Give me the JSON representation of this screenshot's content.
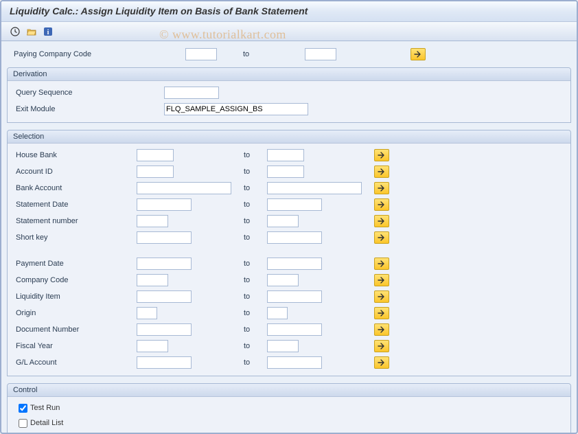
{
  "window": {
    "title": "Liquidity Calc.: Assign Liquidity Item on Basis of Bank Statement"
  },
  "watermark": "© www.tutorialkart.com",
  "toolbar": {
    "execute": "execute",
    "variant": "get-variant",
    "info": "information"
  },
  "top": {
    "paying_cc_label": "Paying Company Code",
    "paying_cc_from": "",
    "to_label": "to",
    "paying_cc_to": ""
  },
  "derivation": {
    "title": "Derivation",
    "query_seq_label": "Query Sequence",
    "query_seq": "",
    "exit_module_label": "Exit Module",
    "exit_module": "FLQ_SAMPLE_ASSIGN_BS"
  },
  "selection": {
    "title": "Selection",
    "to_label": "to",
    "rows": [
      {
        "key": "house_bank",
        "label": "House Bank",
        "wfrom": "w-s2",
        "wto": "w-s2",
        "from": "",
        "to": ""
      },
      {
        "key": "account_id",
        "label": "Account ID",
        "wfrom": "w-s2",
        "wto": "w-s2",
        "from": "",
        "to": ""
      },
      {
        "key": "bank_account",
        "label": "Bank Account",
        "wfrom": "w-lg",
        "wto": "w-lg",
        "from": "",
        "to": ""
      },
      {
        "key": "stmt_date",
        "label": "Statement Date",
        "wfrom": "w-md",
        "wto": "w-md",
        "from": "",
        "to": ""
      },
      {
        "key": "stmt_number",
        "label": "Statement number",
        "wfrom": "w-sm",
        "wto": "w-sm",
        "from": "",
        "to": ""
      },
      {
        "key": "short_key",
        "label": "Short key",
        "wfrom": "w-md",
        "wto": "w-md",
        "from": "",
        "to": ""
      }
    ],
    "rows2": [
      {
        "key": "payment_date",
        "label": "Payment Date",
        "wfrom": "w-md",
        "wto": "w-md",
        "from": "",
        "to": ""
      },
      {
        "key": "company_code",
        "label": "Company Code",
        "wfrom": "w-sm",
        "wto": "w-sm",
        "from": "",
        "to": ""
      },
      {
        "key": "liq_item",
        "label": "Liquidity Item",
        "wfrom": "w-md",
        "wto": "w-md",
        "from": "",
        "to": ""
      },
      {
        "key": "origin",
        "label": "Origin",
        "wfrom": "w-xs",
        "wto": "w-xs",
        "from": "",
        "to": ""
      },
      {
        "key": "doc_number",
        "label": "Document Number",
        "wfrom": "w-md",
        "wto": "w-md",
        "from": "",
        "to": ""
      },
      {
        "key": "fiscal_year",
        "label": "Fiscal Year",
        "wfrom": "w-sm",
        "wto": "w-sm",
        "from": "",
        "to": ""
      },
      {
        "key": "gl_account",
        "label": "G/L Account",
        "wfrom": "w-md",
        "wto": "w-md",
        "from": "",
        "to": ""
      }
    ]
  },
  "control": {
    "title": "Control",
    "test_run_label": "Test Run",
    "test_run": true,
    "detail_list_label": "Detail List",
    "detail_list": false
  }
}
